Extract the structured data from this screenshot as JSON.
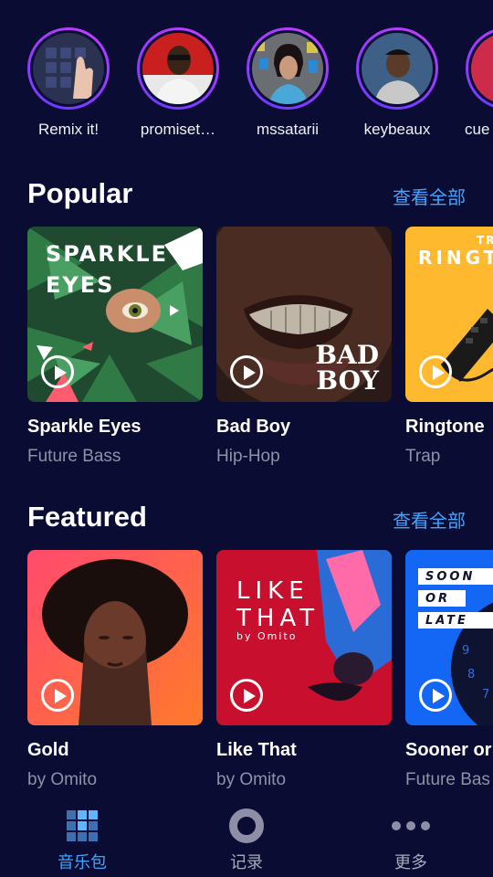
{
  "stories": [
    {
      "label": "Remix it!",
      "icon": "launchpad-hand-icon"
    },
    {
      "label": "promiset…",
      "icon": "artist-avatar"
    },
    {
      "label": "mssatarii",
      "icon": "artist-avatar"
    },
    {
      "label": "keybeaux",
      "icon": "artist-avatar"
    },
    {
      "label": "cue",
      "icon": "artist-avatar"
    }
  ],
  "popular": {
    "title": "Popular",
    "see_all": "查看全部",
    "cards": [
      {
        "title": "Sparkle Eyes",
        "subtitle": "Future Bass",
        "cover_line1": "SPARKLE",
        "cover_line2": "EYES"
      },
      {
        "title": "Bad Boy",
        "subtitle": "Hip-Hop",
        "cover_line1": "BAD",
        "cover_line2": "BOY"
      },
      {
        "title": "Ringtone",
        "subtitle": "Trap",
        "cover_line1": "TR",
        "cover_line2": "RINGT"
      }
    ]
  },
  "featured": {
    "title": "Featured",
    "see_all": "查看全部",
    "cards": [
      {
        "title": "Gold",
        "subtitle": "by Omito"
      },
      {
        "title": "Like That",
        "subtitle": "by Omito",
        "cover_line1": "LIKE",
        "cover_line2": "THAT",
        "cover_line3": "by Omito"
      },
      {
        "title": "Sooner or",
        "subtitle": "Future Bas",
        "cover_line1": "SOON",
        "cover_line2": "OR",
        "cover_line3": "LATE"
      }
    ]
  },
  "nav": {
    "items": [
      {
        "label": "音乐包",
        "icon": "grid-icon",
        "active": true
      },
      {
        "label": "记录",
        "icon": "record-icon",
        "active": false
      },
      {
        "label": "更多",
        "icon": "more-dots-icon",
        "active": false
      }
    ]
  },
  "colors": {
    "background": "#0b0c33",
    "accent": "#3fa4ff",
    "subtitle": "#8f91a6"
  }
}
